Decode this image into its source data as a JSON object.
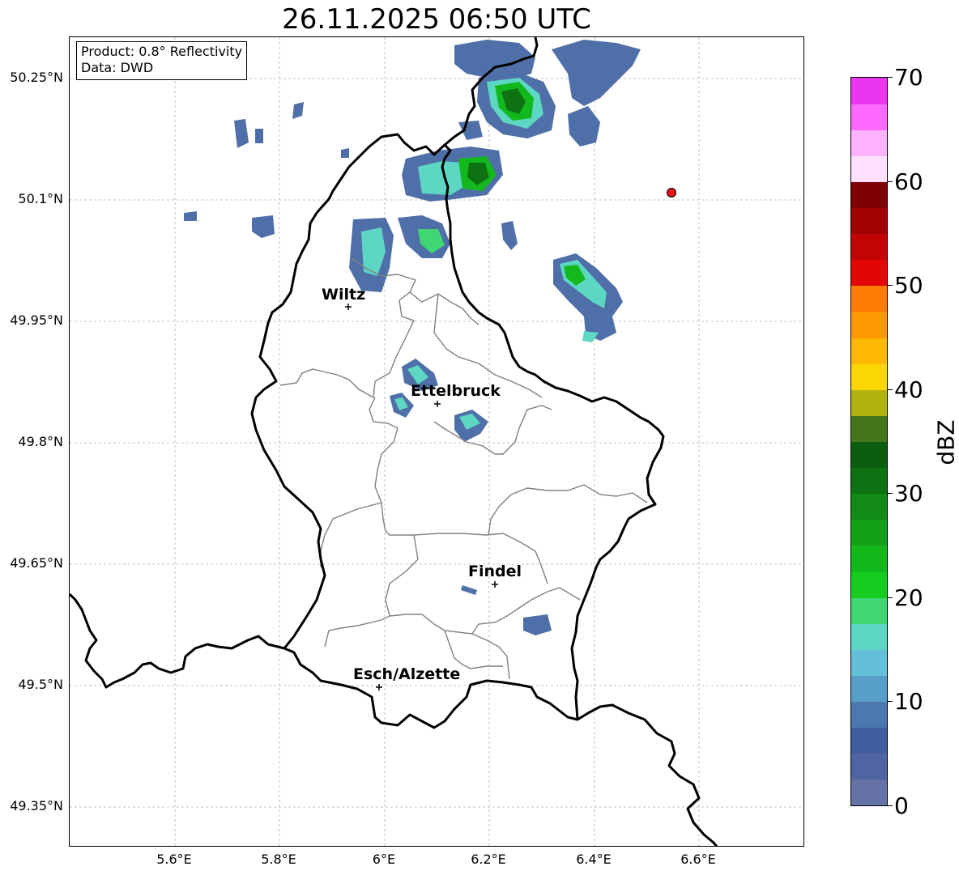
{
  "title": "26.11.2025 06:50 UTC",
  "info_box": {
    "line1": "Product: 0.8° Reflectivity",
    "line2": "Data: DWD"
  },
  "axes": {
    "lat_ticks": [
      "50.25°N",
      "50.1°N",
      "49.95°N",
      "49.8°N",
      "49.65°N",
      "49.5°N",
      "49.35°N"
    ],
    "lon_ticks": [
      "5.6°E",
      "5.8°E",
      "6°E",
      "6.2°E",
      "6.4°E",
      "6.6°E"
    ]
  },
  "cities": [
    {
      "name": "Wiltz",
      "lon": 5.93,
      "lat": 49.968
    },
    {
      "name": "Ettelbruck",
      "lon": 6.1,
      "lat": 49.848
    },
    {
      "name": "Findel",
      "lon": 6.21,
      "lat": 49.626
    },
    {
      "name": "Esch/Alzette",
      "lon": 5.99,
      "lat": 49.499
    }
  ],
  "radar_site": {
    "lon": 6.548,
    "lat": 50.11,
    "color": "#e8141c"
  },
  "colorbar": {
    "label": "dBZ",
    "ticks": [
      "0",
      "10",
      "20",
      "30",
      "40",
      "50",
      "60",
      "70"
    ],
    "colors": [
      "#6472a6",
      "#4f64a0",
      "#415c9f",
      "#4c78b0",
      "#579ec8",
      "#64c0d9",
      "#5dd6c3",
      "#3fd774",
      "#15cd21",
      "#13b81c",
      "#12a018",
      "#128b16",
      "#0e7213",
      "#0b5e10",
      "#46761b",
      "#b1b30d",
      "#fcd601",
      "#fdb801",
      "#fd9a02",
      "#fd7c01",
      "#e30606",
      "#c10404",
      "#a00202",
      "#7d0101",
      "#ffe0ff",
      "#ffb3ff",
      "#ff69ff",
      "#e837ef"
    ]
  },
  "colors": {
    "border": "#000000",
    "canton": "#808080",
    "grid": "#b0b0b0"
  }
}
